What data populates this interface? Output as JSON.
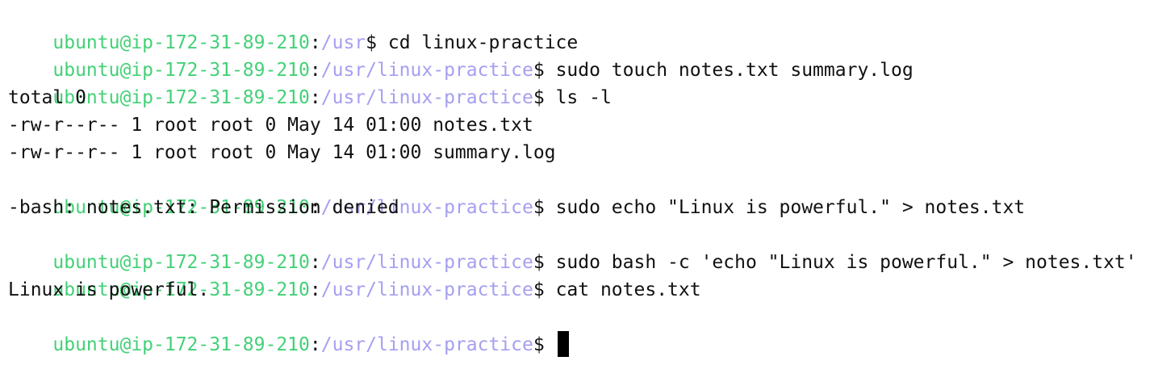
{
  "terminal": {
    "colors": {
      "user": "#43d177",
      "path": "#a59ff0",
      "text": "#111111",
      "background": "#ffffff",
      "cursor": "#000000"
    },
    "lines": [
      {
        "type": "prompt",
        "user": "ubuntu@ip-172-31-89-210",
        "colon": ":",
        "path": "/usr",
        "dollar": "$",
        "command": " cd linux-practice"
      },
      {
        "type": "prompt",
        "user": "ubuntu@ip-172-31-89-210",
        "colon": ":",
        "path": "/usr/linux-practice",
        "dollar": "$",
        "command": " sudo touch notes.txt summary.log"
      },
      {
        "type": "prompt",
        "user": "ubuntu@ip-172-31-89-210",
        "colon": ":",
        "path": "/usr/linux-practice",
        "dollar": "$",
        "command": " ls -l"
      },
      {
        "type": "output",
        "text": "total 0"
      },
      {
        "type": "output",
        "text": "-rw-r--r-- 1 root root 0 May 14 01:00 notes.txt"
      },
      {
        "type": "output",
        "text": "-rw-r--r-- 1 root root 0 May 14 01:00 summary.log"
      },
      {
        "type": "prompt",
        "user": "ubuntu@ip-172-31-89-210",
        "colon": ":",
        "path": "/usr/linux-practice",
        "dollar": "$",
        "command": " sudo echo \"Linux is powerful.\" > notes.txt"
      },
      {
        "type": "output",
        "text": "-bash: notes.txt: Permission denied"
      },
      {
        "type": "prompt",
        "user": "ubuntu@ip-172-31-89-210",
        "colon": ":",
        "path": "/usr/linux-practice",
        "dollar": "$",
        "command": " sudo bash -c 'echo \"Linux is powerful.\" > notes.txt'"
      },
      {
        "type": "prompt",
        "user": "ubuntu@ip-172-31-89-210",
        "colon": ":",
        "path": "/usr/linux-practice",
        "dollar": "$",
        "command": " cat notes.txt"
      },
      {
        "type": "output",
        "text": "Linux is powerful."
      },
      {
        "type": "prompt",
        "user": "ubuntu@ip-172-31-89-210",
        "colon": ":",
        "path": "/usr/linux-practice",
        "dollar": "$",
        "command": " ",
        "cursor": true
      }
    ]
  }
}
